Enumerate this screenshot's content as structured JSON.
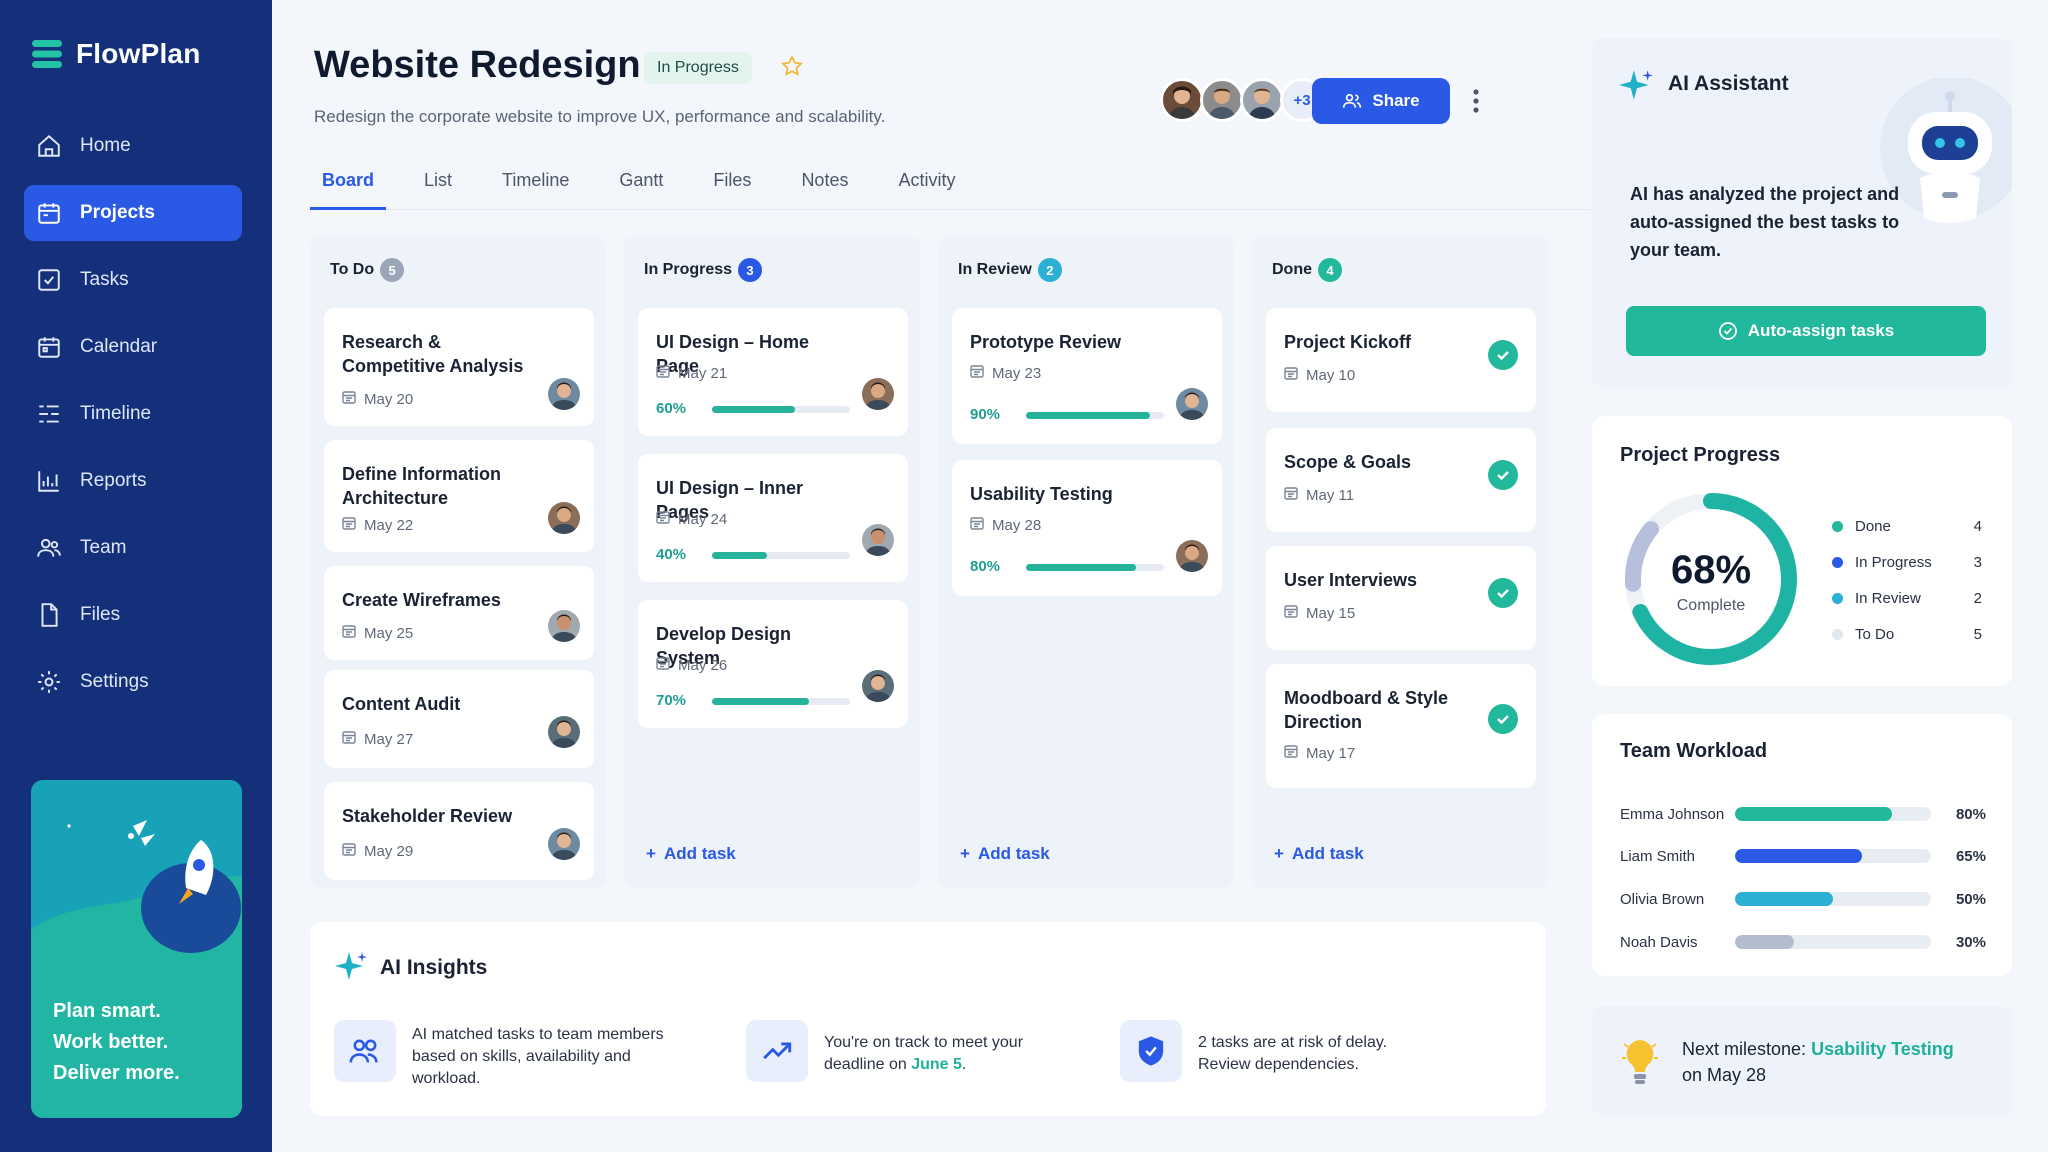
{
  "app": {
    "name": "FlowPlan"
  },
  "sidebar": {
    "items": [
      {
        "label": "Home",
        "icon": "home-icon"
      },
      {
        "label": "Projects",
        "icon": "projects-icon"
      },
      {
        "label": "Tasks",
        "icon": "tasks-icon"
      },
      {
        "label": "Calendar",
        "icon": "calendar-icon"
      },
      {
        "label": "Timeline",
        "icon": "timeline-icon"
      },
      {
        "label": "Reports",
        "icon": "reports-icon"
      },
      {
        "label": "Team",
        "icon": "team-icon"
      },
      {
        "label": "Files",
        "icon": "files-icon"
      },
      {
        "label": "Settings",
        "icon": "settings-icon"
      }
    ],
    "active": "Projects",
    "promo": {
      "line1": "Plan smart.",
      "line2": "Work better.",
      "line3": "Deliver more."
    }
  },
  "header": {
    "title": "Website Redesign",
    "status": "In Progress",
    "subtitle": "Redesign the corporate website to improve UX, performance and scalability.",
    "more_members": "+3",
    "share_label": "Share"
  },
  "tabs": [
    "Board",
    "List",
    "Timeline",
    "Gantt",
    "Files",
    "Notes",
    "Activity"
  ],
  "board": {
    "add_task_label": "Add task",
    "columns": [
      {
        "name": "To Do",
        "count": "5",
        "color": "#9aa5b8",
        "cards": [
          {
            "title": "Research & Competitive Analysis",
            "date": "May 20"
          },
          {
            "title": "Define Information Architecture",
            "date": "May 22"
          },
          {
            "title": "Create Wireframes",
            "date": "May 25"
          },
          {
            "title": "Content Audit",
            "date": "May 27"
          },
          {
            "title": "Stakeholder Review",
            "date": "May 29"
          }
        ]
      },
      {
        "name": "In Progress",
        "count": "3",
        "color": "#2a59e6",
        "cards": [
          {
            "title": "UI Design – Home Page",
            "date": "May 21",
            "progress": "60%",
            "progress_value": 60
          },
          {
            "title": "UI Design – Inner Pages",
            "date": "May 24",
            "progress": "40%",
            "progress_value": 40
          },
          {
            "title": "Develop Design System",
            "date": "May 26",
            "progress": "70%",
            "progress_value": 70
          }
        ]
      },
      {
        "name": "In Review",
        "count": "2",
        "color": "#2ab0d4",
        "cards": [
          {
            "title": "Prototype Review",
            "date": "May 23",
            "progress": "90%",
            "progress_value": 90
          },
          {
            "title": "Usability Testing",
            "date": "May 28",
            "progress": "80%",
            "progress_value": 80
          }
        ]
      },
      {
        "name": "Done",
        "count": "4",
        "color": "#22b89c",
        "cards": [
          {
            "title": "Project Kickoff",
            "date": "May 10"
          },
          {
            "title": "Scope & Goals",
            "date": "May 11"
          },
          {
            "title": "User Interviews",
            "date": "May 15"
          },
          {
            "title": "Moodboard & Style Direction",
            "date": "May 17"
          }
        ]
      }
    ]
  },
  "insights": {
    "title": "AI Insights",
    "items": [
      {
        "text": "AI matched tasks to team members based on skills, availability and workload."
      },
      {
        "text_before": "You're on track to meet your deadline on ",
        "highlight": "June 5",
        "text_after": "."
      },
      {
        "text": "2 tasks are at risk of delay. Review dependencies."
      }
    ]
  },
  "ai_assistant": {
    "title": "AI Assistant",
    "message": "AI has analyzed the project and auto-assigned the best tasks to your team.",
    "button": "Auto-assign tasks"
  },
  "project_progress": {
    "title": "Project Progress",
    "percent": "68%",
    "percent_value": 68,
    "label": "Complete",
    "legend": [
      {
        "name": "Done",
        "value": "4",
        "color": "#22b89c"
      },
      {
        "name": "In Progress",
        "value": "3",
        "color": "#2a59e6"
      },
      {
        "name": "In Review",
        "value": "2",
        "color": "#2ab0d4"
      },
      {
        "name": "To Do",
        "value": "5",
        "color": "#e3e8f0"
      }
    ]
  },
  "team_workload": {
    "title": "Team Workload",
    "members": [
      {
        "name": "Emma Johnson",
        "percent": "80%",
        "value": 80,
        "color": "#22b89c"
      },
      {
        "name": "Liam Smith",
        "percent": "65%",
        "value": 65,
        "color": "#2a59e6"
      },
      {
        "name": "Olivia Brown",
        "percent": "50%",
        "value": 50,
        "color": "#2ab0d4"
      },
      {
        "name": "Noah Davis",
        "percent": "30%",
        "value": 30,
        "color": "#b4bdd0"
      }
    ]
  },
  "milestone": {
    "prefix": "Next milestone: ",
    "name": "Usability Testing",
    "date": "on May 28"
  }
}
